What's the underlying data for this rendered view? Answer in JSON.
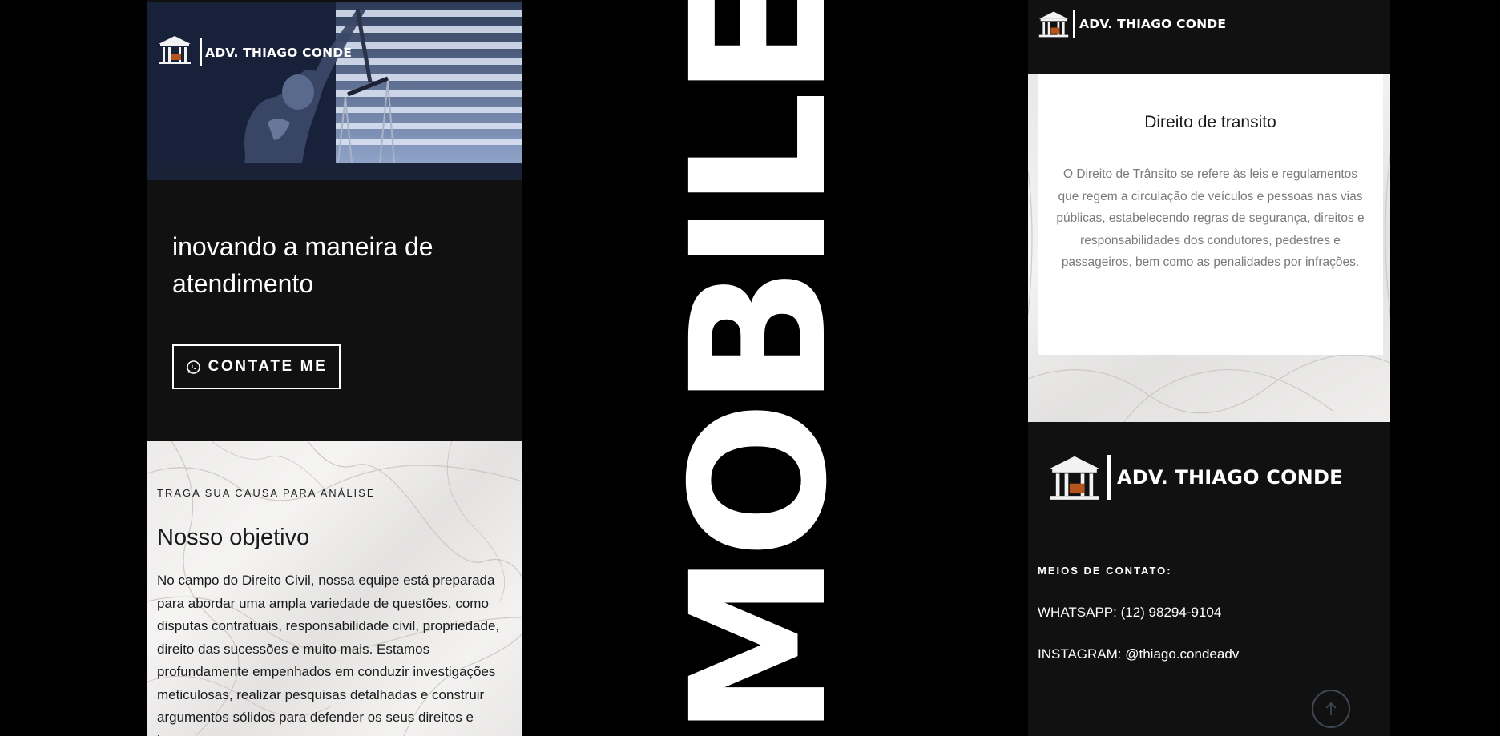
{
  "left_phone": {
    "brand": "ADV. THIAGO CONDE",
    "headline": "inovando a maneira de atendimento",
    "cta_label": "CONTATE ME",
    "eyebrow": "TRAGA SUA CAUSA PARA ANÁLISE",
    "section_title": "Nosso objetivo",
    "section_body": "No campo do Direito Civil, nossa equipe está preparada para abordar uma ampla variedade de questões, como disputas contratuais, responsabilidade civil, propriedade, direito das sucessões e muito mais. Estamos profundamente empenhados em conduzir investigações meticulosas, realizar pesquisas detalhadas e construir argumentos sólidos para defender os seus direitos e interesses."
  },
  "center": {
    "label": "MOBILE"
  },
  "right_phone": {
    "brand": "ADV. THIAGO CONDE",
    "card_title": "Direito de transito",
    "card_body": "O Direito de Trânsito se refere às leis e regulamentos que regem a circulação de veículos e pessoas nas vias públicas, estabelecendo regras de segurança, direitos e responsabilidades dos condutores, pedestres e passageiros, bem como as penalidades por infrações.",
    "footer_brand": "ADV. THIAGO CONDE",
    "contact_label": "MEIOS DE CONTATO:",
    "whatsapp": "WHATSAPP: (12) 98294-9104",
    "instagram": "INSTAGRAM: @thiago.condeadv"
  },
  "icons": {
    "logo": "courthouse-gavel-icon",
    "cta": "whatsapp-icon",
    "scroll": "arrow-up-icon"
  },
  "colors": {
    "page_bg": "#000000",
    "phone_bg": "#111111",
    "text_light": "#ffffff",
    "text_dark": "#1a1a1a",
    "text_muted": "#7a7a7a",
    "logo_accent": "#b5541c"
  }
}
